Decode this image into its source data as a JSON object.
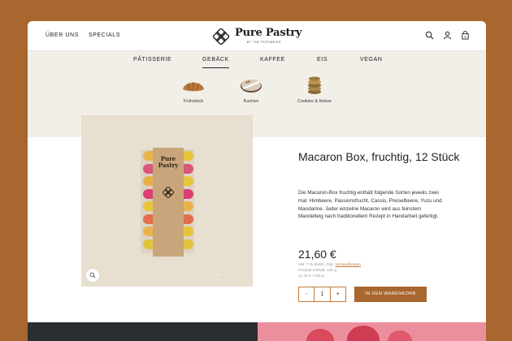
{
  "header": {
    "nav_left": [
      "ÜBER UNS",
      "SPECIALS"
    ],
    "logo_title": "Pure Pastry",
    "logo_subtitle": "BY TIM TESTMEIER",
    "icons": [
      "search-icon",
      "user-icon",
      "cart-icon"
    ]
  },
  "categories": [
    "PÂTISSERIE",
    "GEBÄCK",
    "KAFFEE",
    "EIS",
    "VEGAN"
  ],
  "active_category": "GEBÄCK",
  "subcategories": [
    {
      "label": "Frühstück",
      "icon": "croissant-icon"
    },
    {
      "label": "Kuchen",
      "icon": "cake-icon"
    },
    {
      "label": "Cookies & Kekse",
      "icon": "cookies-icon"
    }
  ],
  "product": {
    "box_title": "Pure Pastry",
    "title": "Macaron Box, fruchtig, 12 Stück",
    "description": "Die Macaron-Box fruchtig enthält folgende Sorten jeweils zwei mal: Himbeere, Passionsfrucht, Cassis, Preiselbeere, Yuzu und Mandarine. Jeder einzelne Macaron wird aus feinstem Mandelteig nach traditionellem Rezept in Handarbeit gefertigt.",
    "price": "21,60 €",
    "meta_line1_prefix": "inkl. 7 % MwSt. zzgl.",
    "meta_shipping_link": "Versandkosten",
    "meta_line2": "Produkt enthält: 192 g",
    "meta_line3": "11,25 € / 100 g",
    "quantity": "1",
    "minus_label": "-",
    "plus_label": "+",
    "add_to_cart": "IN DEN WARENKORB"
  },
  "colors": {
    "accent": "#a8672e",
    "background": "#a8672e",
    "category_bg": "#f2efe9",
    "image_bg": "#e7dfcf"
  }
}
